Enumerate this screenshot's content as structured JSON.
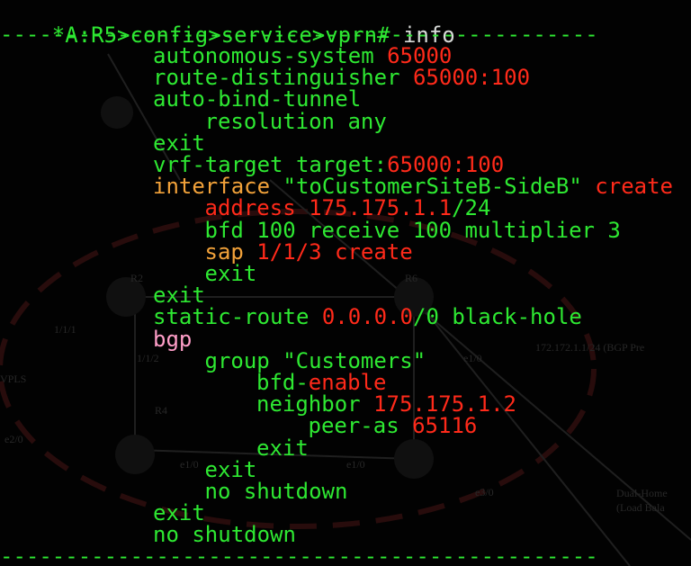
{
  "terminal": {
    "prompt": {
      "text": "*A:R5>config>service>vprn# ",
      "command": "info"
    },
    "rule_top": "----------------------------------------------",
    "rule_bottom": "----------------------------------------------",
    "lines": [
      {
        "indent": 0,
        "segments": [
          {
            "t": "autonomous-system ",
            "c": "g"
          },
          {
            "t": "65000",
            "c": "r"
          }
        ]
      },
      {
        "indent": 0,
        "segments": [
          {
            "t": "route-distinguisher ",
            "c": "g"
          },
          {
            "t": "65000:100",
            "c": "r"
          }
        ]
      },
      {
        "indent": 0,
        "segments": [
          {
            "t": "auto-bind-tunnel",
            "c": "g"
          }
        ]
      },
      {
        "indent": 1,
        "segments": [
          {
            "t": "resolution any",
            "c": "g"
          }
        ]
      },
      {
        "indent": 0,
        "segments": [
          {
            "t": "exit",
            "c": "g"
          }
        ]
      },
      {
        "indent": 0,
        "segments": [
          {
            "t": "vrf-target target:",
            "c": "g"
          },
          {
            "t": "65000:100",
            "c": "r"
          }
        ]
      },
      {
        "indent": 0,
        "segments": [
          {
            "t": "interface ",
            "c": "y"
          },
          {
            "t": "\"toCustomerSiteB-SideB\"",
            "c": "g"
          },
          {
            "t": " create",
            "c": "r"
          }
        ]
      },
      {
        "indent": 1,
        "segments": [
          {
            "t": "address ",
            "c": "r"
          },
          {
            "t": "175.175.1.1",
            "c": "r"
          },
          {
            "t": "/24",
            "c": "g"
          }
        ]
      },
      {
        "indent": 1,
        "segments": [
          {
            "t": "bfd 100 receive 100 multiplier 3",
            "c": "g"
          }
        ]
      },
      {
        "indent": 1,
        "segments": [
          {
            "t": "sap ",
            "c": "y"
          },
          {
            "t": "1/1/3",
            "c": "r"
          },
          {
            "t": " create",
            "c": "r"
          }
        ]
      },
      {
        "indent": 1,
        "segments": [
          {
            "t": "exit",
            "c": "g"
          }
        ]
      },
      {
        "indent": 0,
        "segments": [
          {
            "t": "exit",
            "c": "g"
          }
        ]
      },
      {
        "indent": 0,
        "segments": [
          {
            "t": "static-route ",
            "c": "g"
          },
          {
            "t": "0.0.0.0",
            "c": "r"
          },
          {
            "t": "/0 black-hole",
            "c": "g"
          }
        ]
      },
      {
        "indent": 0,
        "segments": [
          {
            "t": "bgp",
            "c": "p"
          }
        ]
      },
      {
        "indent": 1,
        "segments": [
          {
            "t": "group \"Customers\"",
            "c": "g"
          }
        ]
      },
      {
        "indent": 2,
        "segments": [
          {
            "t": "bfd-",
            "c": "g"
          },
          {
            "t": "enable",
            "c": "r"
          }
        ]
      },
      {
        "indent": 2,
        "segments": [
          {
            "t": "neighbor ",
            "c": "g"
          },
          {
            "t": "175.175.1.2",
            "c": "r"
          }
        ]
      },
      {
        "indent": 3,
        "segments": [
          {
            "t": "peer-as ",
            "c": "g"
          },
          {
            "t": "65116",
            "c": "r"
          }
        ]
      },
      {
        "indent": 2,
        "segments": [
          {
            "t": "exit",
            "c": "g"
          }
        ]
      },
      {
        "indent": 1,
        "segments": [
          {
            "t": "exit",
            "c": "g"
          }
        ]
      },
      {
        "indent": 1,
        "segments": [
          {
            "t": "no shutdown",
            "c": "g"
          }
        ]
      },
      {
        "indent": 0,
        "segments": [
          {
            "t": "exit",
            "c": "g"
          }
        ]
      },
      {
        "indent": 0,
        "segments": [
          {
            "t": "no shutdown",
            "c": "g"
          }
        ]
      }
    ]
  },
  "background_diagram": {
    "labels": [
      "R2",
      "R6",
      "R4",
      "1/1/1",
      "1/1/2",
      "e1/0",
      "e1/0",
      "e1/0",
      "e2/0",
      "e3/0",
      "VPLS",
      "172.172.1.1/24 (BGP Pre",
      "Dual-Home",
      "(Load Bala"
    ]
  },
  "colors": {
    "green": "#2ee832",
    "red": "#ff2a1a",
    "orange": "#f2a23a",
    "pink": "#ff9ec8",
    "background": "#020202"
  }
}
